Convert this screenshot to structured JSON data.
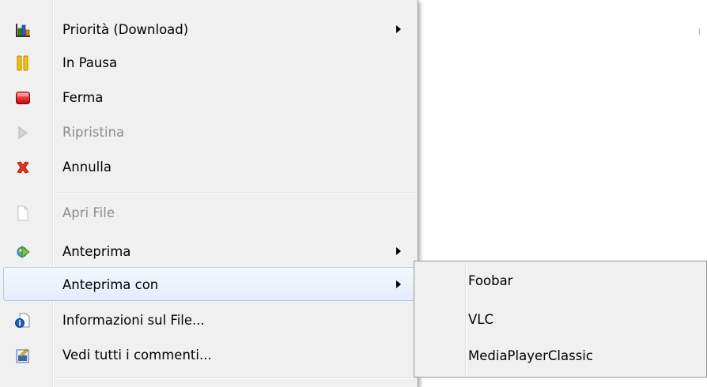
{
  "colors": {
    "menu_bg": "#f0f0f0",
    "hover_bg": "#e3edfa",
    "hover_border": "#aeccf1",
    "disabled_text": "#8d8d8d"
  },
  "menu": {
    "items": [
      {
        "label": "Priorità (Download)",
        "icon": "priority-chart-icon",
        "submenu": true,
        "enabled": true
      },
      {
        "label": "In Pausa",
        "icon": "pause-icon",
        "submenu": false,
        "enabled": true
      },
      {
        "label": "Ferma",
        "icon": "stop-icon",
        "submenu": false,
        "enabled": true
      },
      {
        "label": "Ripristina",
        "icon": "resume-play-icon",
        "submenu": false,
        "enabled": false
      },
      {
        "label": "Annulla",
        "icon": "cancel-x-icon",
        "submenu": false,
        "enabled": true
      },
      {
        "label": "Apri File",
        "icon": "file-icon",
        "submenu": false,
        "enabled": false
      },
      {
        "label": "Anteprima",
        "icon": "preview-icon",
        "submenu": true,
        "enabled": true
      },
      {
        "label": "Anteprima con",
        "icon": "",
        "submenu": true,
        "enabled": true,
        "highlighted": true
      },
      {
        "label": "Informazioni sul File...",
        "icon": "file-info-icon",
        "submenu": false,
        "enabled": true
      },
      {
        "label": "Vedi tutti i commenti...",
        "icon": "comments-icon",
        "submenu": false,
        "enabled": true
      }
    ]
  },
  "submenu": {
    "items": [
      {
        "label": "Foobar"
      },
      {
        "label": "VLC"
      },
      {
        "label": "MediaPlayerClassic"
      }
    ]
  }
}
